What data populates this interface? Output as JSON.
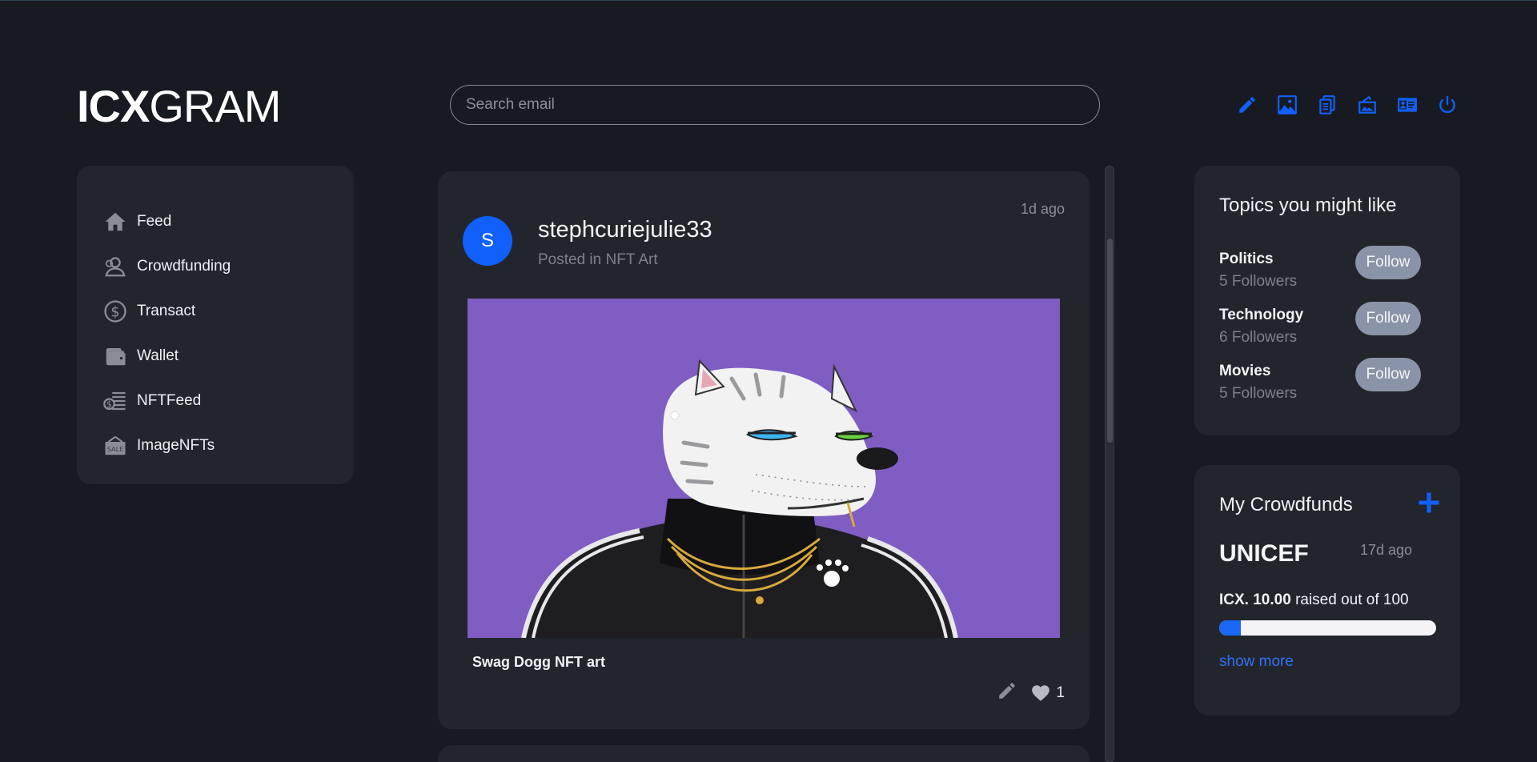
{
  "app": {
    "logo_bold": "ICX",
    "logo_light": "GRAM"
  },
  "search": {
    "placeholder": "Search email",
    "value": ""
  },
  "toolbar": {
    "icons": [
      "pencil-icon",
      "image-icon",
      "copy-icon",
      "image-sale-icon",
      "id-card-icon",
      "power-icon"
    ],
    "accent": "#1160fb"
  },
  "sidebar": {
    "items": [
      {
        "label": "Feed",
        "icon": "home-icon"
      },
      {
        "label": "Crowdfunding",
        "icon": "people-icon"
      },
      {
        "label": "Transact",
        "icon": "dollar-circle-icon"
      },
      {
        "label": "Wallet",
        "icon": "wallet-icon"
      },
      {
        "label": "NFTFeed",
        "icon": "coins-stack-icon"
      },
      {
        "label": "ImageNFTs",
        "icon": "sale-sign-icon"
      }
    ]
  },
  "post": {
    "avatar_letter": "S",
    "username": "stephcuriejulie33",
    "posted_in": "Posted in NFT Art",
    "time": "1d ago",
    "image_subject": "Swag Dogg NFT art",
    "caption": "Swag Dogg NFT art",
    "likes": "1"
  },
  "topics": {
    "title": "Topics you might like",
    "items": [
      {
        "name": "Politics",
        "followers": "5 Followers",
        "button": "Follow"
      },
      {
        "name": "Technology",
        "followers": "6 Followers",
        "button": "Follow"
      },
      {
        "name": "Movies",
        "followers": "5 Followers",
        "button": "Follow"
      }
    ]
  },
  "crowdfunds": {
    "title": "My Crowdfunds",
    "fund_name": "UNICEF",
    "time": "17d ago",
    "raised_amount": "ICX. 10.00",
    "raised_suffix": "raised out of 100",
    "progress_fraction": 0.1,
    "show_more": "show more"
  }
}
